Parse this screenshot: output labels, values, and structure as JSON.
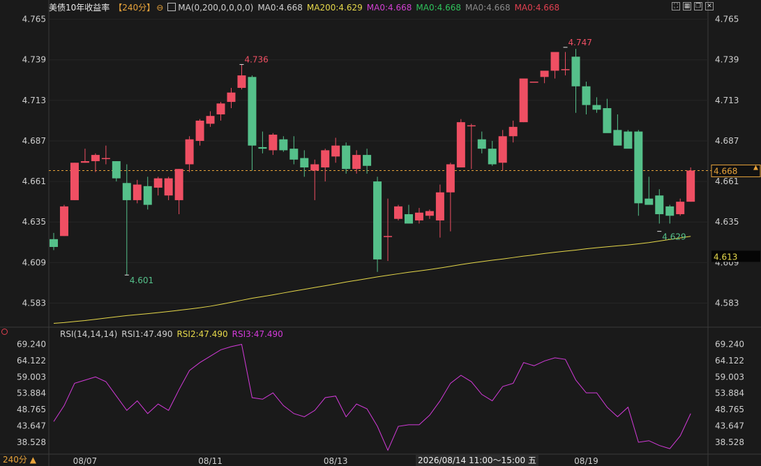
{
  "header": {
    "symbol": "美债10年收益率",
    "timeframe": "【240分】",
    "ma_params": "MA(0,200,0,0,0,0)",
    "ma_values": [
      {
        "label": "MA0:4.668",
        "color": "#cfcfcf"
      },
      {
        "label": "MA200:4.629",
        "color": "#e6d84a"
      },
      {
        "label": "MA0:4.668",
        "color": "#d040d0"
      },
      {
        "label": "MA0:4.668",
        "color": "#2fc25b"
      },
      {
        "label": "MA0:4.668",
        "color": "#8a8a8a"
      },
      {
        "label": "MA0:4.668",
        "color": "#e04050"
      }
    ]
  },
  "toolbar_icons": [
    "fullscreen-icon",
    "grid-icon",
    "window-icon",
    "close-icon"
  ],
  "rsi_header": {
    "params": "RSI(14,14,14)",
    "rsi1": "RSI1:47.490",
    "rsi2": "RSI2:47.490",
    "rsi3": "RSI3:47.490"
  },
  "timeframe_footer": "240分",
  "crosshair_stamp": "2026/08/14 11:00～15:00 五",
  "colors": {
    "up": "#ef4f63",
    "down": "#55c08a",
    "ma200": "#e6d84a",
    "rsi": "#d33ad9",
    "last": "#e8a33a"
  },
  "chart_data": {
    "type": "candlestick",
    "y_ticks": [
      "4.765",
      "4.739",
      "4.713",
      "4.687",
      "4.661",
      "4.635",
      "4.609",
      "4.583"
    ],
    "ylim": [
      4.568,
      4.7684
    ],
    "x_ticks": [
      {
        "index": 3,
        "label": "08/07"
      },
      {
        "index": 15,
        "label": "08/11"
      },
      {
        "index": 27,
        "label": "08/13"
      },
      {
        "index": 51,
        "label": "08/19"
      }
    ],
    "last_price": "4.668",
    "ma200_last": "4.613",
    "annotations": [
      {
        "index": 7,
        "value": 4.601,
        "text": "4.601",
        "color": "#55c08a"
      },
      {
        "index": 18,
        "value": 4.736,
        "text": "4.736",
        "color": "#ef4f63"
      },
      {
        "index": 49,
        "value": 4.747,
        "text": "4.747",
        "color": "#ef4f63"
      },
      {
        "index": 58,
        "value": 4.629,
        "text": "4.629",
        "color": "#55c08a"
      }
    ],
    "candles": [
      [
        4.624,
        4.628,
        4.617,
        4.619
      ],
      [
        4.626,
        4.646,
        4.626,
        4.645
      ],
      [
        4.649,
        4.673,
        4.649,
        4.673
      ],
      [
        4.673,
        4.682,
        4.673,
        4.674
      ],
      [
        4.674,
        4.679,
        4.667,
        4.678
      ],
      [
        4.676,
        4.684,
        4.672,
        4.676
      ],
      [
        4.674,
        4.674,
        4.661,
        4.663
      ],
      [
        4.66,
        4.672,
        4.601,
        4.649
      ],
      [
        4.649,
        4.662,
        4.647,
        4.659
      ],
      [
        4.658,
        4.664,
        4.643,
        4.646
      ],
      [
        4.657,
        4.664,
        4.652,
        4.663
      ],
      [
        4.652,
        4.664,
        4.649,
        4.663
      ],
      [
        4.649,
        4.669,
        4.64,
        4.669
      ],
      [
        4.672,
        4.69,
        4.667,
        4.688
      ],
      [
        4.687,
        4.701,
        4.684,
        4.7
      ],
      [
        4.698,
        4.706,
        4.696,
        4.703
      ],
      [
        4.704,
        4.712,
        4.7,
        4.711
      ],
      [
        4.712,
        4.721,
        4.708,
        4.718
      ],
      [
        4.721,
        4.736,
        4.72,
        4.729
      ],
      [
        4.728,
        4.729,
        4.668,
        4.684
      ],
      [
        4.683,
        4.693,
        4.679,
        4.682
      ],
      [
        4.681,
        4.692,
        4.678,
        4.691
      ],
      [
        4.688,
        4.69,
        4.68,
        4.681
      ],
      [
        4.682,
        4.69,
        4.672,
        4.675
      ],
      [
        4.676,
        4.681,
        4.664,
        4.67
      ],
      [
        4.668,
        4.675,
        4.649,
        4.672
      ],
      [
        4.67,
        4.682,
        4.661,
        4.681
      ],
      [
        4.677,
        4.689,
        4.673,
        4.684
      ],
      [
        4.684,
        4.686,
        4.666,
        4.669
      ],
      [
        4.669,
        4.681,
        4.666,
        4.678
      ],
      [
        4.678,
        4.682,
        4.666,
        4.671
      ],
      [
        4.661,
        4.664,
        4.603,
        4.611
      ],
      [
        4.626,
        4.65,
        4.61,
        4.626
      ],
      [
        4.637,
        4.646,
        4.636,
        4.645
      ],
      [
        4.64,
        4.646,
        4.634,
        4.634
      ],
      [
        4.636,
        4.644,
        4.634,
        4.641
      ],
      [
        4.639,
        4.643,
        4.637,
        4.642
      ],
      [
        4.636,
        4.659,
        4.625,
        4.654
      ],
      [
        4.654,
        4.673,
        4.629,
        4.672
      ],
      [
        4.67,
        4.701,
        4.67,
        4.699
      ],
      [
        4.697,
        4.698,
        4.669,
        4.697
      ],
      [
        4.688,
        4.693,
        4.679,
        4.682
      ],
      [
        4.682,
        4.687,
        4.671,
        4.672
      ],
      [
        4.673,
        4.694,
        4.668,
        4.69
      ],
      [
        4.69,
        4.7,
        4.686,
        4.696
      ],
      [
        4.699,
        4.726,
        4.699,
        4.727
      ],
      [
        4.725,
        4.725,
        4.725,
        4.725
      ],
      [
        4.728,
        4.73,
        4.724,
        4.732
      ],
      [
        4.732,
        4.736,
        4.727,
        4.744
      ],
      [
        4.733,
        4.744,
        4.729,
        4.733
      ],
      [
        4.741,
        4.746,
        4.705,
        4.722
      ],
      [
        4.722,
        4.725,
        4.704,
        4.71
      ],
      [
        4.71,
        4.715,
        4.705,
        4.707
      ],
      [
        4.708,
        4.714,
        4.693,
        4.692
      ],
      [
        4.694,
        4.704,
        4.69,
        4.684
      ],
      [
        4.693,
        4.694,
        4.683,
        4.682
      ],
      [
        4.693,
        4.694,
        4.639,
        4.647
      ],
      [
        4.65,
        4.664,
        4.649,
        4.646
      ],
      [
        4.652,
        4.656,
        4.634,
        4.64
      ],
      [
        4.645,
        4.646,
        4.634,
        4.639
      ],
      [
        4.64,
        4.65,
        4.639,
        4.648
      ],
      [
        4.648,
        4.67,
        4.648,
        4.668
      ]
    ],
    "ma200": [
      4.57,
      4.5705,
      4.5712,
      4.5718,
      4.5726,
      4.5734,
      4.5742,
      4.575,
      4.5756,
      4.5762,
      4.5769,
      4.5776,
      4.5784,
      4.5792,
      4.58,
      4.581,
      4.5822,
      4.5835,
      4.5848,
      4.5861,
      4.5872,
      4.5883,
      4.5895,
      4.5907,
      4.5918,
      4.593,
      4.5941,
      4.5953,
      4.5965,
      4.5976,
      4.5987,
      4.5998,
      4.6008,
      4.6018,
      4.6028,
      4.6036,
      4.6045,
      4.6055,
      4.6066,
      4.6077,
      4.6087,
      4.6096,
      4.6105,
      4.6113,
      4.6122,
      4.6131,
      4.6139,
      4.6148,
      4.6156,
      4.6163,
      4.617,
      4.6178,
      4.6185,
      4.6191,
      4.6197,
      4.6203,
      4.621,
      4.6218,
      4.6228,
      4.6238,
      4.6248,
      4.6258
    ],
    "rsi": {
      "ylim": [
        35.0,
        70.0
      ],
      "y_ticks": [
        "69.240",
        "64.122",
        "59.003",
        "53.884",
        "48.765",
        "43.647",
        "38.528"
      ],
      "values": [
        45.0,
        50.0,
        57.0,
        58.0,
        59.0,
        57.5,
        53.0,
        48.5,
        51.5,
        47.5,
        50.5,
        48.5,
        55.0,
        61.0,
        63.5,
        65.5,
        67.5,
        68.5,
        69.2,
        52.5,
        52.0,
        54.0,
        50.0,
        47.5,
        46.5,
        48.5,
        52.5,
        53.0,
        46.5,
        50.5,
        49.0,
        43.5,
        36.0,
        43.5,
        44.0,
        44.0,
        47.0,
        51.5,
        57.0,
        59.5,
        57.5,
        53.5,
        51.5,
        56.0,
        57.0,
        63.5,
        62.5,
        64.0,
        65.0,
        64.5,
        58.0,
        54.0,
        54.0,
        49.5,
        46.5,
        49.5,
        38.5,
        39.0,
        37.5,
        36.5,
        40.5,
        47.5
      ]
    }
  }
}
